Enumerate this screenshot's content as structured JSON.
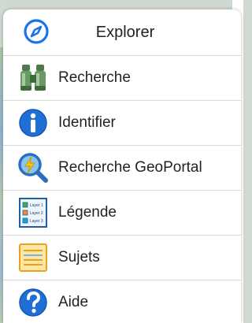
{
  "header": {
    "title": "Explorer",
    "icon": "compass-icon"
  },
  "menu": {
    "items": [
      {
        "label": "Recherche",
        "icon": "binoculars-icon"
      },
      {
        "label": "Identifier",
        "icon": "info-icon"
      },
      {
        "label": "Recherche GeoPortal",
        "icon": "geoportal-search-icon"
      },
      {
        "label": "Légende",
        "icon": "legend-icon",
        "legend_layers": [
          "Layer 1",
          "Layer 2",
          "Layer 3"
        ]
      },
      {
        "label": "Sujets",
        "icon": "topics-icon"
      },
      {
        "label": "Aide",
        "icon": "help-icon"
      }
    ]
  },
  "colors": {
    "accent_blue": "#1a73e8",
    "panel_bg": "#ffffff",
    "divider": "#d9d9d9"
  }
}
